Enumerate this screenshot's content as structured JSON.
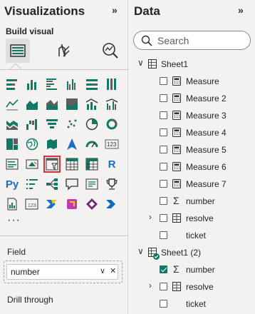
{
  "viz": {
    "title": "Visualizations",
    "collapse": "»",
    "build_visual": "Build visual",
    "more": "···",
    "field_label": "Field",
    "field_value": "number",
    "drill_label": "Drill through"
  },
  "data": {
    "title": "Data",
    "collapse": "»",
    "search_placeholder": "Search",
    "tables": [
      {
        "name": "Sheet1",
        "fields": [
          "Measure",
          "Measure 2",
          "Measure 3",
          "Measure 4",
          "Measure 5",
          "Measure 6",
          "Measure 7",
          "number",
          "resolve",
          "ticket"
        ]
      },
      {
        "name": "Sheet1 (2)",
        "fields": [
          "number",
          "resolve",
          "ticket"
        ]
      }
    ]
  },
  "colors": {
    "accent": "#117865",
    "selected_outline": "#d13438"
  }
}
